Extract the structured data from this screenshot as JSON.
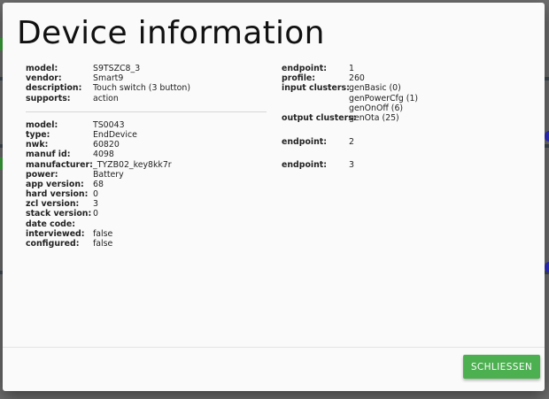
{
  "dialog": {
    "title": "Device information",
    "close_label": "SCHLIESSEN"
  },
  "info_top": [
    {
      "key": "model:",
      "value": "S9TSZC8_3"
    },
    {
      "key": "vendor:",
      "value": "Smart9"
    },
    {
      "key": "description:",
      "value": "Touch switch (3 button)"
    },
    {
      "key": "supports:",
      "value": "action"
    }
  ],
  "info_bottom": [
    {
      "key": "model:",
      "value": "TS0043"
    },
    {
      "key": "type:",
      "value": "EndDevice"
    },
    {
      "key": "nwk:",
      "value": "60820"
    },
    {
      "key": "manuf id:",
      "value": "4098"
    },
    {
      "key": "manufacturer:",
      "value": "_TYZB02_key8kk7r"
    },
    {
      "key": "power:",
      "value": "Battery"
    },
    {
      "key": "app version:",
      "value": "68"
    },
    {
      "key": "hard version:",
      "value": "0"
    },
    {
      "key": "zcl version:",
      "value": "3"
    },
    {
      "key": "stack version:",
      "value": "0"
    },
    {
      "key": "date code:",
      "value": ""
    },
    {
      "key": "interviewed:",
      "value": "false"
    },
    {
      "key": "configured:",
      "value": "false"
    }
  ],
  "endpoints": {
    "ep1": {
      "endpoint_label": "endpoint:",
      "endpoint_value": "1",
      "profile_label": "profile:",
      "profile_value": "260",
      "input_label": "input clusters:",
      "input_clusters": [
        "genBasic (0)",
        "genPowerCfg (1)",
        "genOnOff (6)"
      ],
      "output_label": "output clusters:",
      "output_value": "genOta (25)"
    },
    "ep2": {
      "endpoint_label": "endpoint:",
      "endpoint_value": "2"
    },
    "ep3": {
      "endpoint_label": "endpoint:",
      "endpoint_value": "3"
    }
  }
}
